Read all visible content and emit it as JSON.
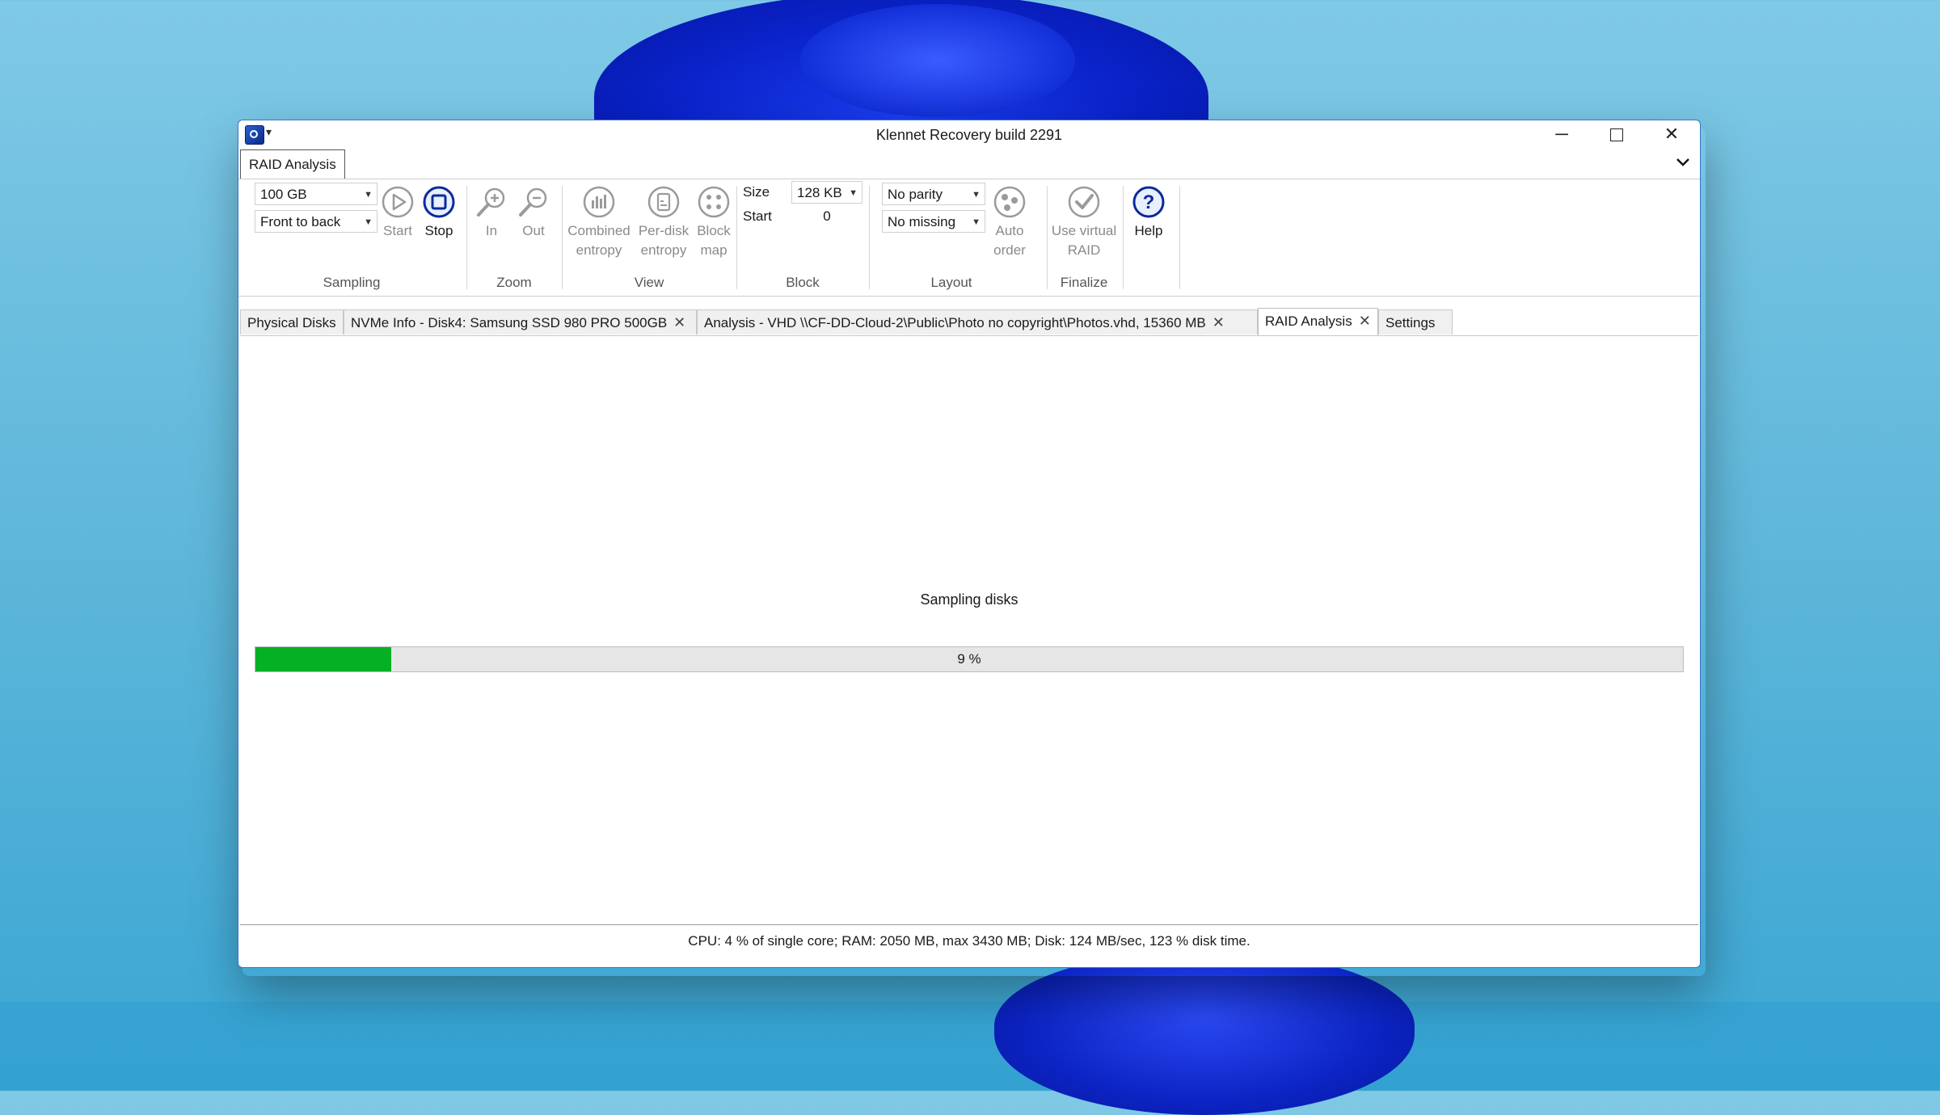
{
  "window": {
    "title": "Klennet Recovery build 2291",
    "minimize_glyph": "─",
    "close_glyph": "✕",
    "qa_glyph": "▾"
  },
  "ribbon": {
    "tab_label": "RAID Analysis",
    "collapse_glyph": "⌄",
    "sampling": {
      "label": "Sampling",
      "size_value": "100 GB",
      "order_value": "Front to back",
      "start_label": "Start",
      "stop_label": "Stop"
    },
    "zoom": {
      "label": "Zoom",
      "in_label": "In",
      "out_label": "Out"
    },
    "view": {
      "label": "View",
      "combined_line1": "Combined",
      "combined_line2": "entropy",
      "perdisk_line1": "Per-disk",
      "perdisk_line2": "entropy",
      "blockmap_line1": "Block",
      "blockmap_line2": "map"
    },
    "block": {
      "label": "Block",
      "size_label": "Size",
      "size_value": "128 KB",
      "start_label": "Start",
      "start_value": "0"
    },
    "layout": {
      "label": "Layout",
      "parity_value": "No parity",
      "missing_value": "No missing",
      "auto_line1": "Auto",
      "auto_line2": "order"
    },
    "finalize": {
      "label": "Finalize",
      "virtual_line1": "Use virtual",
      "virtual_line2": "RAID"
    },
    "help": {
      "label": "Help"
    }
  },
  "doc_tabs": [
    {
      "label": "Physical Disks",
      "closable": false
    },
    {
      "label": "NVMe Info - Disk4:  Samsung SSD 980 PRO 500GB",
      "closable": true
    },
    {
      "label": "Analysis - VHD \\\\CF-DD-Cloud-2\\Public\\Photo no copyright\\Photos.vhd, 15360 MB",
      "closable": true
    },
    {
      "label": "RAID Analysis",
      "closable": true,
      "active": true
    },
    {
      "label": "Settings",
      "closable": false
    }
  ],
  "tab_close_glyph": "✕",
  "main": {
    "status_text": "Sampling disks",
    "progress_text": "9 %",
    "progress_fraction": 0.095
  },
  "statusbar": {
    "text": "CPU: 4 % of single core; RAM: 2050 MB, max 3430 MB; Disk: 124 MB/sec, 123 % disk time."
  },
  "colors": {
    "progress_fill": "#06b025",
    "window_border": "#3b74c4",
    "wallpaper_bloom": "#0a22c8"
  }
}
